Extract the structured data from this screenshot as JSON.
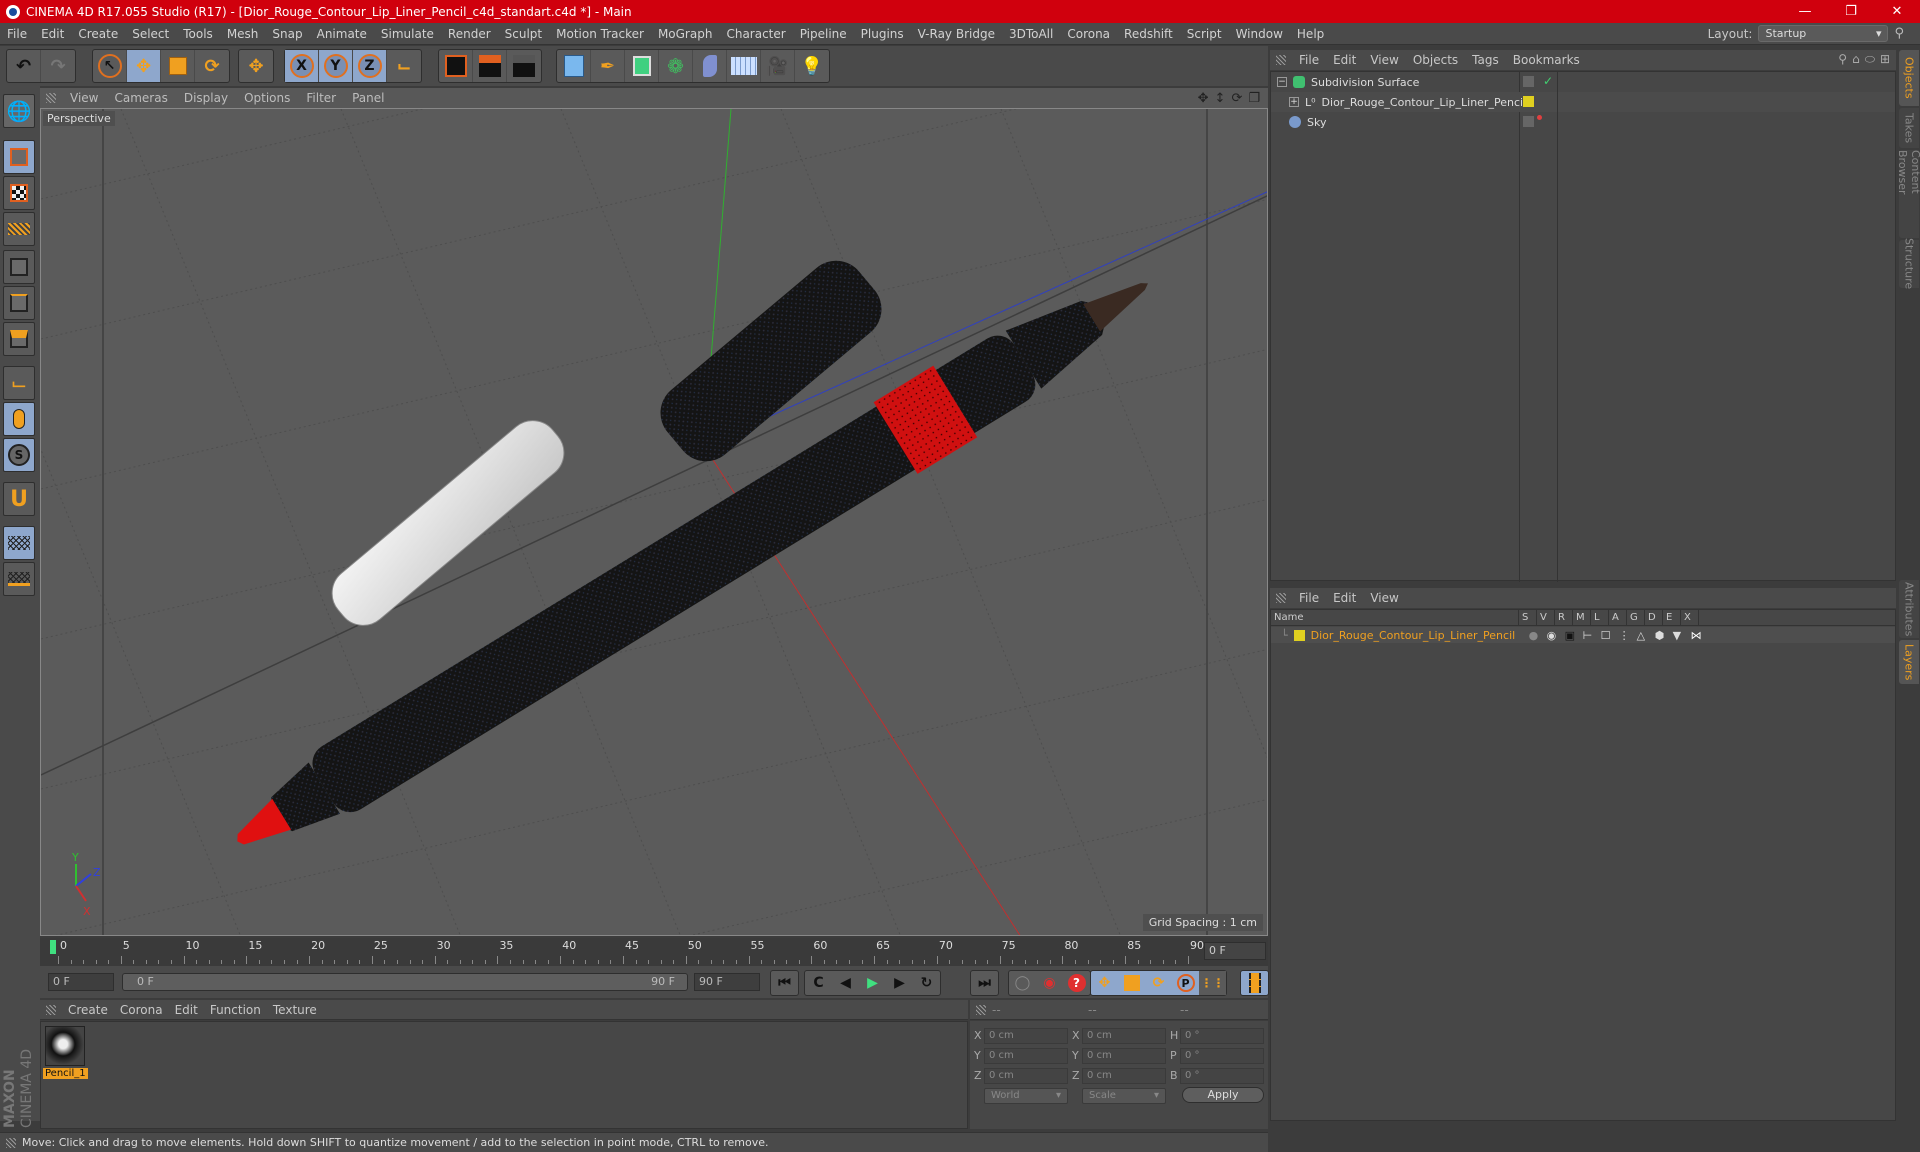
{
  "window": {
    "title": "CINEMA 4D R17.055 Studio (R17) - [Dior_Rouge_Contour_Lip_Liner_Pencil_c4d_standart.c4d *] - Main",
    "controls": [
      "minimize",
      "maximize",
      "close"
    ]
  },
  "menubar": {
    "items": [
      "File",
      "Edit",
      "Create",
      "Select",
      "Tools",
      "Mesh",
      "Snap",
      "Animate",
      "Simulate",
      "Render",
      "Sculpt",
      "Motion Tracker",
      "MoGraph",
      "Character",
      "Pipeline",
      "Plugins",
      "V-Ray Bridge",
      "3DToAll",
      "Corona",
      "Redshift",
      "Script",
      "Window",
      "Help"
    ],
    "layout_label": "Layout:",
    "layout_value": "Startup"
  },
  "toolbar": {
    "groups": [
      [
        "undo-icon",
        "redo-icon"
      ],
      [
        "select-icon",
        "move-icon",
        "scale-icon",
        "rotate-icon"
      ],
      [
        "move-alt-icon"
      ],
      [
        "x-axis-lock",
        "y-axis-lock",
        "z-axis-lock",
        "world-coords-icon"
      ],
      [
        "render-view-icon",
        "render-picture-viewer-icon",
        "render-settings-icon"
      ],
      [
        "cube-icon",
        "pen-icon",
        "subdivision-icon",
        "cloner-icon",
        "deformer-icon",
        "floor-icon",
        "camera-icon",
        "light-icon"
      ]
    ],
    "axis_labels": [
      "X",
      "Y",
      "Z"
    ]
  },
  "left_toolbar": {
    "items": [
      "model-mode",
      "texture-mode",
      "workplane-mode",
      "points-mode",
      "edges-mode",
      "polygons-mode",
      "axis-mode",
      "tweak-mode",
      "solo-mode",
      "snap-toggle",
      "workplane-lock",
      "workplane-sync"
    ]
  },
  "viewport": {
    "menu": [
      "View",
      "Cameras",
      "Display",
      "Options",
      "Filter",
      "Panel"
    ],
    "label": "Perspective",
    "grid_spacing": "Grid Spacing : 1 cm",
    "axis_labels": {
      "x": "X",
      "y": "Y",
      "z": "Z"
    },
    "colors": {
      "x_axis": "#c03030",
      "y_axis": "#30b030",
      "z_axis": "#3040c0"
    }
  },
  "timeline": {
    "ticks": [
      "0",
      "5",
      "10",
      "15",
      "20",
      "25",
      "30",
      "35",
      "40",
      "45",
      "50",
      "55",
      "60",
      "65",
      "70",
      "75",
      "80",
      "85",
      "90"
    ],
    "current_frame": "0 F"
  },
  "transport": {
    "start_field": "0 F",
    "range_start": "0 F",
    "range_end": "90 F",
    "end_field": "90 F"
  },
  "material_manager": {
    "menu": [
      "Create",
      "Corona",
      "Edit",
      "Function",
      "Texture"
    ],
    "materials": [
      {
        "name": "Pencil_1"
      }
    ]
  },
  "coordinates": {
    "headers": [
      "--",
      "--",
      "--"
    ],
    "rows": [
      {
        "label1": "X",
        "val1": "0 cm",
        "label2": "X",
        "val2": "0 cm",
        "label3": "H",
        "val3": "0 °"
      },
      {
        "label1": "Y",
        "val1": "0 cm",
        "label2": "Y",
        "val2": "0 cm",
        "label3": "P",
        "val3": "0 °"
      },
      {
        "label1": "Z",
        "val1": "0 cm",
        "label2": "Z",
        "val2": "0 cm",
        "label3": "B",
        "val3": "0 °"
      }
    ],
    "coord_system": "World",
    "mode": "Scale",
    "apply_label": "Apply"
  },
  "status_bar": {
    "text": "Move: Click and drag to move elements. Hold down SHIFT to quantize movement / add to the selection in point mode, CTRL to remove."
  },
  "object_manager": {
    "menu": [
      "File",
      "Edit",
      "View",
      "Objects",
      "Tags",
      "Bookmarks"
    ],
    "objects": [
      {
        "name": "Subdivision Surface",
        "icon": "subdivision-surface-icon",
        "expanded": true
      },
      {
        "name": "Dior_Rouge_Contour_Lip_Liner_Pencil",
        "icon": "null-object-icon",
        "layer_color": "#e0d020"
      },
      {
        "name": "Sky",
        "icon": "sky-icon"
      }
    ]
  },
  "layer_manager": {
    "menu": [
      "File",
      "Edit",
      "View"
    ],
    "columns": [
      "Name",
      "S",
      "V",
      "R",
      "M",
      "L",
      "A",
      "G",
      "D",
      "E",
      "X"
    ],
    "layers": [
      {
        "name": "Dior_Rouge_Contour_Lip_Liner_Pencil",
        "color": "#e0d020"
      }
    ]
  },
  "side_tabs": {
    "top": [
      "Objects",
      "Takes",
      "Content Browser",
      "Structure"
    ],
    "bottom": [
      "Attributes",
      "Layers"
    ],
    "active_top": "Objects",
    "active_bottom": "Layers"
  },
  "branding": {
    "maxon": "MAXON",
    "product": "CINEMA 4D"
  }
}
